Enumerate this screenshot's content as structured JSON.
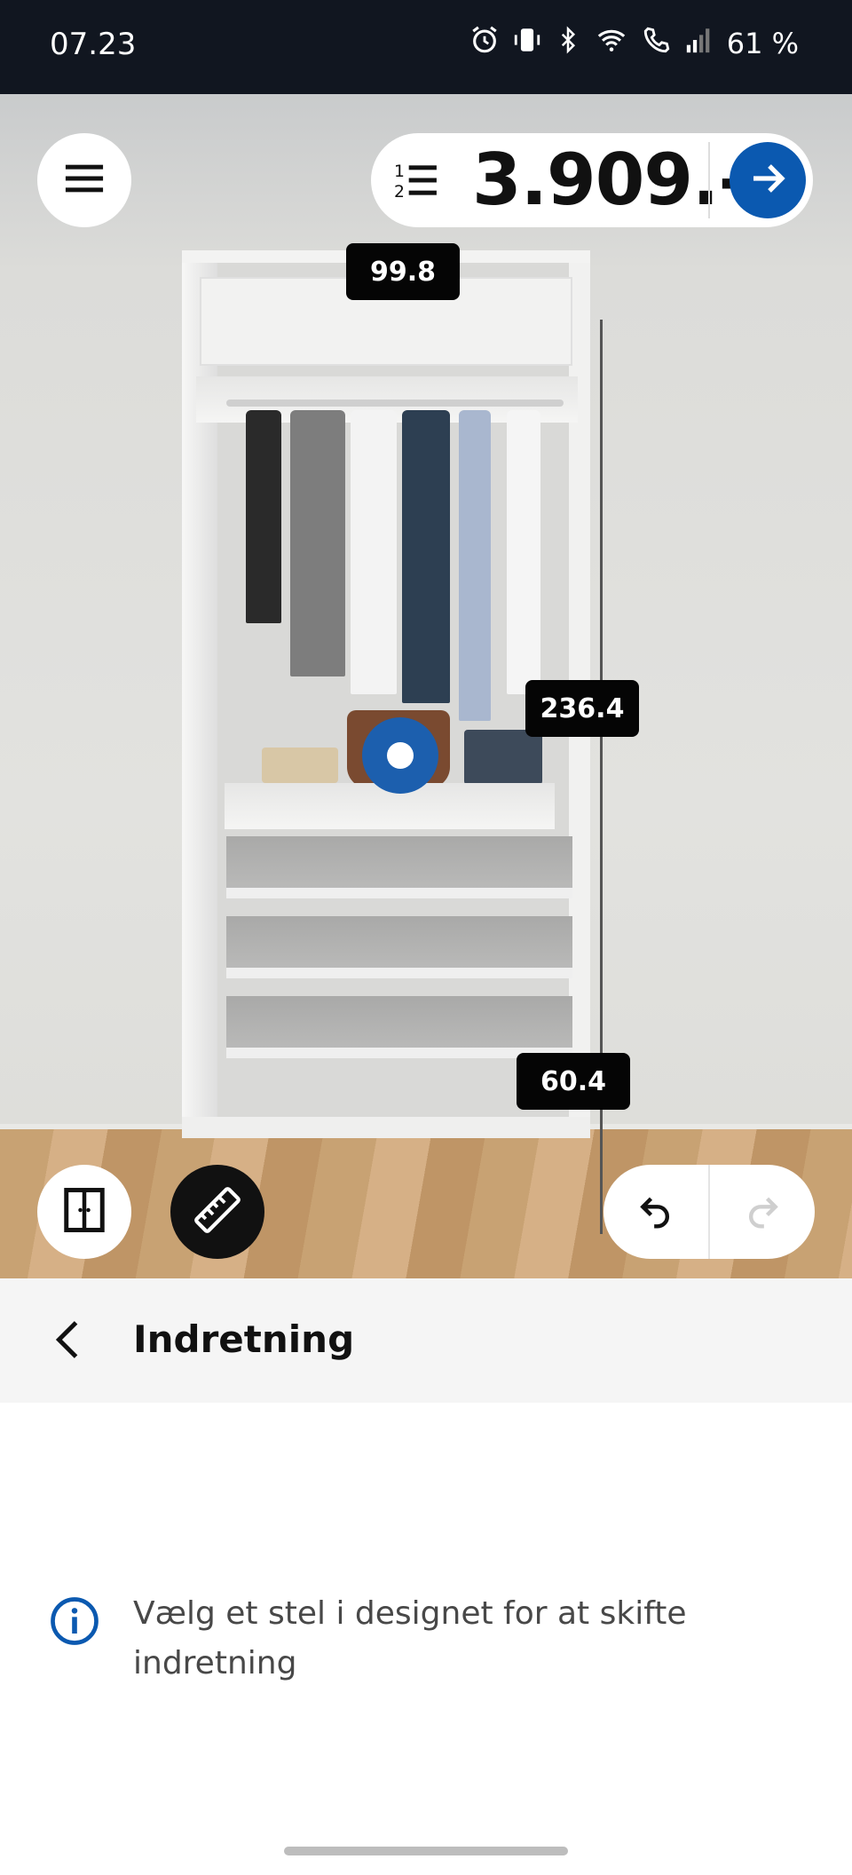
{
  "status_bar": {
    "time": "07.23",
    "battery": "61 %",
    "icons": [
      "alarm-icon",
      "vibrate-icon",
      "bluetooth-icon",
      "wifi-icon",
      "wifi-call-icon",
      "signal-icon"
    ]
  },
  "toolbar": {
    "menu_icon": "hamburger-icon",
    "list_icon": "numbered-list-icon",
    "price": "3.909.-",
    "next_icon": "arrow-right-icon"
  },
  "dimensions": {
    "width": "99.8",
    "height": "236.4",
    "depth": "60.4"
  },
  "canvas_controls": {
    "doors_icon": "wardrobe-doors-icon",
    "measure_icon": "ruler-icon",
    "undo_icon": "undo-icon",
    "redo_icon": "redo-icon"
  },
  "panel": {
    "back_icon": "chevron-left-icon",
    "title": "Indretning",
    "info_icon": "info-icon",
    "info_text": "Vælg et stel i designet for at skifte indretning"
  },
  "colors": {
    "accent_blue": "#0b59b0",
    "status_bar_bg": "#111620",
    "label_bg": "#050505"
  }
}
